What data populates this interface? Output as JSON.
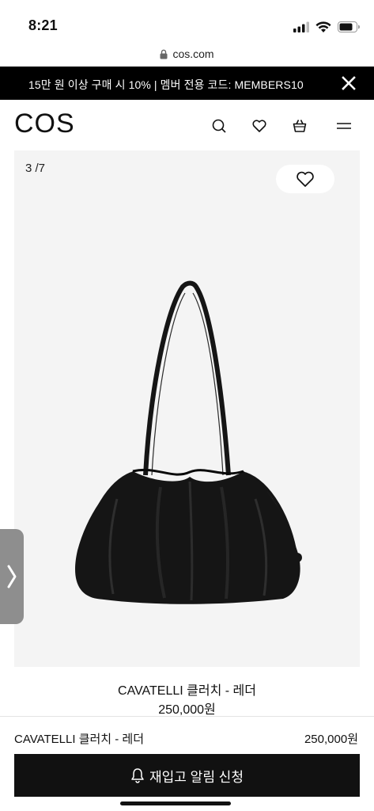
{
  "status_bar": {
    "time": "8:21",
    "icons": [
      "signal-icon",
      "wifi-icon",
      "battery-icon"
    ]
  },
  "url_bar": {
    "domain": "cos.com",
    "icon": "lock-icon"
  },
  "promo": {
    "text": "15만 원 이상 구매 시 10% | 멤버 전용 코드: MEMBERS10",
    "close_icon": "close-icon"
  },
  "header": {
    "logo": "COS",
    "icons": [
      "search-icon",
      "heart-icon",
      "basket-icon",
      "menu-icon"
    ]
  },
  "gallery": {
    "counter": "3 /7",
    "wishlist_icon": "heart-icon",
    "colors": {
      "background": "#f4f4f4",
      "bag": "#151515"
    }
  },
  "side_tab": {
    "icon": "chevron-right-icon"
  },
  "product": {
    "name": "CAVATELLI 클러치 - 레더",
    "price": "250,000원"
  },
  "sticky_bar": {
    "name": "CAVATELLI 클러치 - 레더",
    "price": "250,000원",
    "button_label": "재입고 알림 신청",
    "button_icon": "bell-icon",
    "colors": {
      "button": "#111111"
    }
  }
}
